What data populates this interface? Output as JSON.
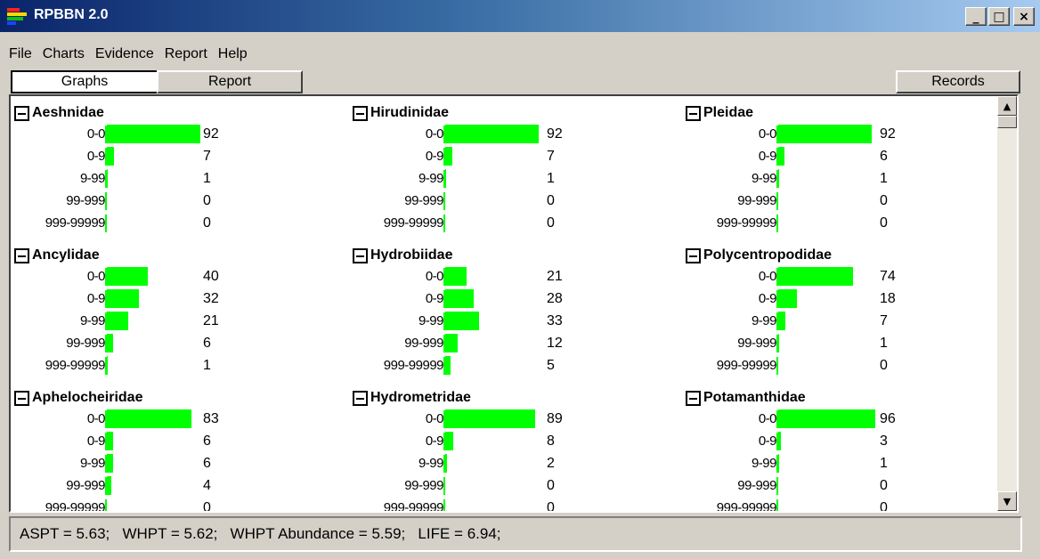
{
  "window": {
    "title": "RPBBN 2.0",
    "icon": "app-bar-icon"
  },
  "title_buttons": {
    "minimize": "_",
    "maximize": "□",
    "close": "×"
  },
  "menu": [
    "File",
    "Charts",
    "Evidence",
    "Report",
    "Help"
  ],
  "tabs": {
    "graphs": "Graphs",
    "report": "Report",
    "records": "Records",
    "active": "Graphs"
  },
  "colors": {
    "bar": "#00ff00",
    "titlebar_start": "#0a246a",
    "titlebar_end": "#a6caf0"
  },
  "chart_data": [
    {
      "type": "bar",
      "title": "Aeshnidae",
      "categories": [
        "0-0",
        "0-9",
        "9-99",
        "99-999",
        "999-99999"
      ],
      "values": [
        92,
        7,
        1,
        0,
        0
      ]
    },
    {
      "type": "bar",
      "title": "Hirudinidae",
      "categories": [
        "0-0",
        "0-9",
        "9-99",
        "99-999",
        "999-99999"
      ],
      "values": [
        92,
        7,
        1,
        0,
        0
      ]
    },
    {
      "type": "bar",
      "title": "Pleidae",
      "categories": [
        "0-0",
        "0-9",
        "9-99",
        "99-999",
        "999-99999"
      ],
      "values": [
        92,
        6,
        1,
        0,
        0
      ]
    },
    {
      "type": "bar",
      "title": "Ancylidae",
      "categories": [
        "0-0",
        "0-9",
        "9-99",
        "99-999",
        "999-99999"
      ],
      "values": [
        40,
        32,
        21,
        6,
        1
      ]
    },
    {
      "type": "bar",
      "title": "Hydrobiidae",
      "categories": [
        "0-0",
        "0-9",
        "9-99",
        "99-999",
        "999-99999"
      ],
      "values": [
        21,
        28,
        33,
        12,
        5
      ]
    },
    {
      "type": "bar",
      "title": "Polycentropodidae",
      "categories": [
        "0-0",
        "0-9",
        "9-99",
        "99-999",
        "999-99999"
      ],
      "values": [
        74,
        18,
        7,
        1,
        0
      ]
    },
    {
      "type": "bar",
      "title": "Aphelocheiridae",
      "categories": [
        "0-0",
        "0-9",
        "9-99",
        "99-999",
        "999-99999"
      ],
      "values": [
        83,
        6,
        6,
        4,
        0
      ]
    },
    {
      "type": "bar",
      "title": "Hydrometridae",
      "categories": [
        "0-0",
        "0-9",
        "9-99",
        "99-999",
        "999-99999"
      ],
      "values": [
        89,
        8,
        2,
        0,
        0
      ]
    },
    {
      "type": "bar",
      "title": "Potamanthidae",
      "categories": [
        "0-0",
        "0-9",
        "9-99",
        "99-999",
        "999-99999"
      ],
      "values": [
        96,
        3,
        1,
        0,
        0
      ]
    }
  ],
  "chart_scale_max": 100,
  "status": "ASPT = 5.63;   WHPT = 5.62;   WHPT Abundance = 5.59;   LIFE = 6.94;"
}
